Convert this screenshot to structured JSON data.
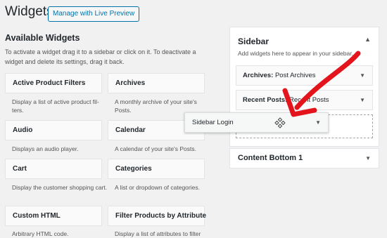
{
  "header": {
    "title": "Widgets",
    "live_preview_label": "Manage with Live Preview"
  },
  "available": {
    "title": "Available Widgets",
    "description": "To activate a widget drag it to a sidebar or click on it. To deactivate a widget and delete its settings, drag it back.",
    "widgets": [
      {
        "name": "Active Product Filters",
        "desc": "Display a list of active product fil-ters."
      },
      {
        "name": "Archives",
        "desc": "A monthly archive of your site's Posts."
      },
      {
        "name": "Audio",
        "desc": "Displays an audio player."
      },
      {
        "name": "Calendar",
        "desc": "A calendar of your site's Posts."
      },
      {
        "name": "Cart",
        "desc": "Display the customer shopping cart."
      },
      {
        "name": "Categories",
        "desc": "A list or dropdown of categories."
      },
      {
        "name": "Custom HTML",
        "desc": "Arbitrary HTML code."
      },
      {
        "name": "Filter Products by Attribute",
        "desc": "Display a list of attributes to filter"
      }
    ]
  },
  "sidebar": {
    "title": "Sidebar",
    "description": "Add widgets here to appear in your sidebar.",
    "widgets": [
      {
        "name": "Archives:",
        "subtitle": "Post Archives"
      },
      {
        "name": "Recent Posts:",
        "subtitle": "Recent Posts"
      }
    ]
  },
  "dragging_widget": {
    "label": "Sidebar Login"
  },
  "content_bottom": {
    "title": "Content Bottom 1"
  },
  "colors": {
    "accent": "#0073aa",
    "annotation": "#e3141b"
  },
  "icons": {
    "expand": "triangle-down",
    "collapse": "triangle-up",
    "move": "move-arrows"
  }
}
